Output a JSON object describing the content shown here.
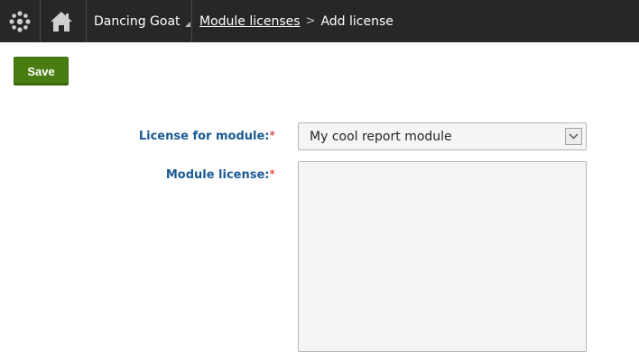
{
  "header": {
    "site_name": "Dancing Goat",
    "breadcrumb": {
      "parent": "Module licenses",
      "separator": ">",
      "current": "Add license"
    }
  },
  "toolbar": {
    "save_label": "Save"
  },
  "form": {
    "module_label": "License for module:",
    "module_required": "*",
    "module_value": "My cool report module",
    "license_label": "Module license:",
    "license_required": "*",
    "license_value": ""
  },
  "colors": {
    "topbar": "#272727",
    "save_button": "#497d11",
    "label": "#1c5a93",
    "required": "#d11b1b"
  },
  "icons": {
    "logo": "kentico-logo-icon",
    "home": "home-icon",
    "site_caret": "caret-icon",
    "select_arrow": "chevron-down-icon"
  }
}
